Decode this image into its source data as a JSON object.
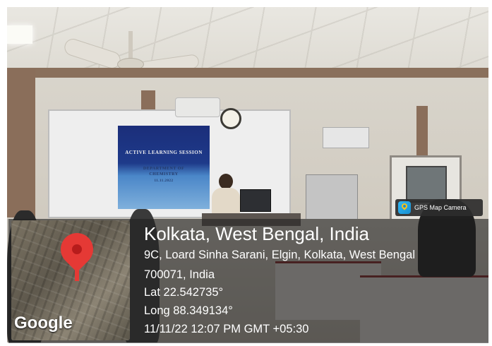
{
  "projection": {
    "line1": "ACTIVE LEARNING SESSION",
    "line2": "DEPARTMENT OF",
    "line3": "CHEMISTRY",
    "line4": "11.11.2022"
  },
  "gps_badge": {
    "label": "GPS Map Camera",
    "icon": "gps-map-camera-logo"
  },
  "map": {
    "brand": "Google",
    "icon": "map-pin"
  },
  "location": {
    "title": "Kolkata, West Bengal, India",
    "address_line1": "9C, Loard Sinha Sarani, Elgin, Kolkata, West Bengal",
    "address_line2": "700071, India",
    "lat": "Lat 22.542735°",
    "long": "Long 88.349134°",
    "timestamp": "11/11/22 12:07 PM GMT +05:30"
  },
  "colors": {
    "pin": "#e53935",
    "overlay": "#1e1e1e",
    "projection_top": "#1b2e7a"
  }
}
